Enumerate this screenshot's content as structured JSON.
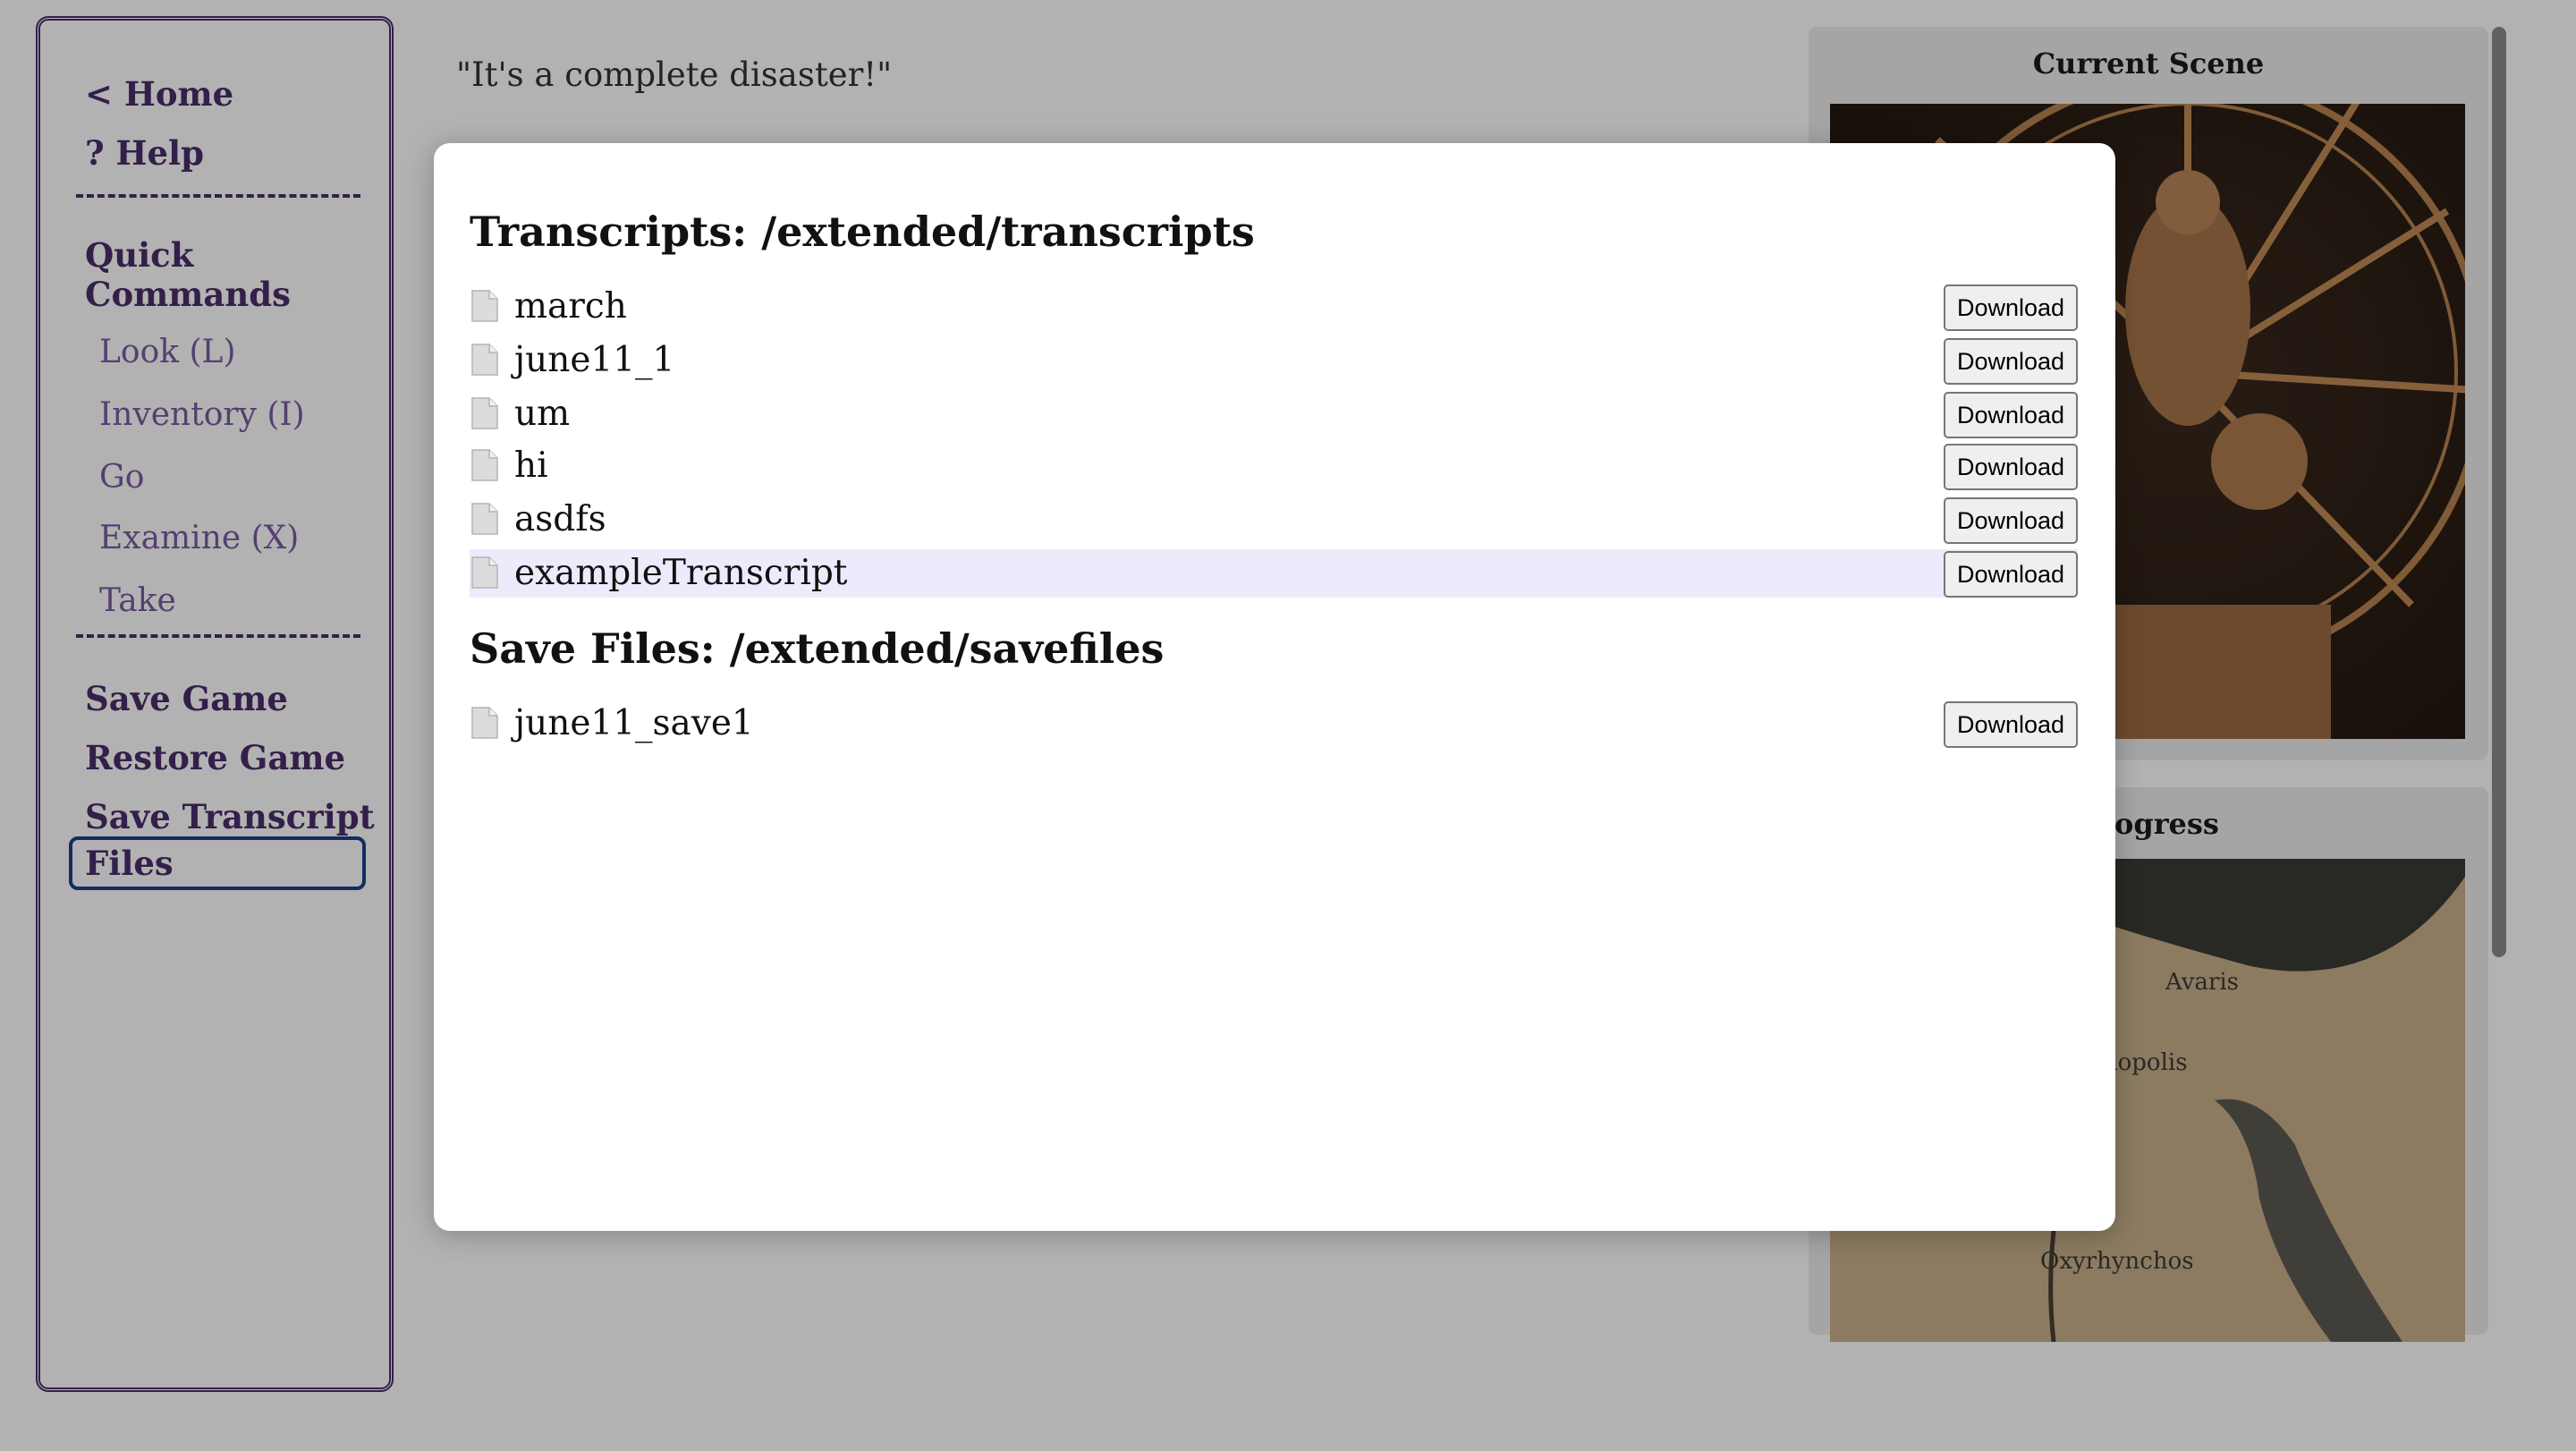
{
  "sidebar": {
    "home": "< Home",
    "help": "? Help",
    "quick_commands_title": "Quick Commands",
    "quick_commands": [
      "Look (L)",
      "Inventory (I)",
      "Go",
      "Examine (X)",
      "Take"
    ],
    "actions": [
      "Save Game",
      "Restore Game",
      "Save Transcript"
    ],
    "files": "Files"
  },
  "main": {
    "quote": "\"It's a complete disaster!\""
  },
  "panels": {
    "scene_title": "Current Scene",
    "progress_title": "Progress",
    "map_labels": [
      "Avaris",
      "liopolis",
      "Oxyrhynchos"
    ]
  },
  "modal": {
    "transcripts_title": "Transcripts: /extended/transcripts",
    "transcripts": [
      "march",
      "june11_1",
      "um",
      "hi",
      "asdfs",
      "exampleTranscript"
    ],
    "savefiles_title": "Save Files: /extended/savefiles",
    "savefiles": [
      "june11_save1"
    ],
    "download_label": "Download"
  },
  "colors": {
    "accent": "#4b2d6b",
    "accent_light": "#7a5ba3",
    "focus_border": "#1e3f8a",
    "row_highlight": "#ebebfb"
  }
}
